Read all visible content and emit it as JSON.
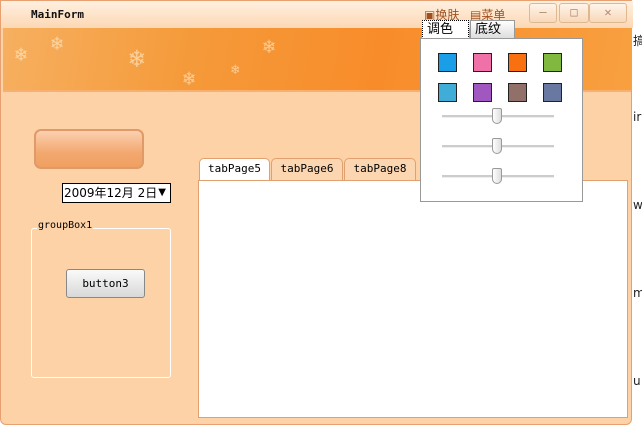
{
  "window": {
    "title": "MainForm",
    "skin_label": "换肤",
    "menu_label": "菜单",
    "minimize": "–",
    "maximize": "□",
    "close": "✕"
  },
  "date_picker": {
    "value": "2009年12月 2日",
    "arrow": "▼"
  },
  "group_box": {
    "label": "groupBox1",
    "button_label": "button3"
  },
  "tabs": [
    {
      "label": "tabPage5",
      "selected": true
    },
    {
      "label": "tabPage6"
    },
    {
      "label": "tabPage8"
    }
  ],
  "skin_popup": {
    "tabs": [
      {
        "label": "调色",
        "selected": true
      },
      {
        "label": "底纹"
      }
    ],
    "swatches": [
      "#1a9ee8",
      "#f070a8",
      "#f87010",
      "#80b840",
      "#40acd8",
      "#a058c0",
      "#907068",
      "#6878a0"
    ],
    "sliders": [
      50,
      50,
      50
    ]
  },
  "background_fragments": [
    "搞",
    "ir",
    "w",
    "m",
    "u"
  ]
}
